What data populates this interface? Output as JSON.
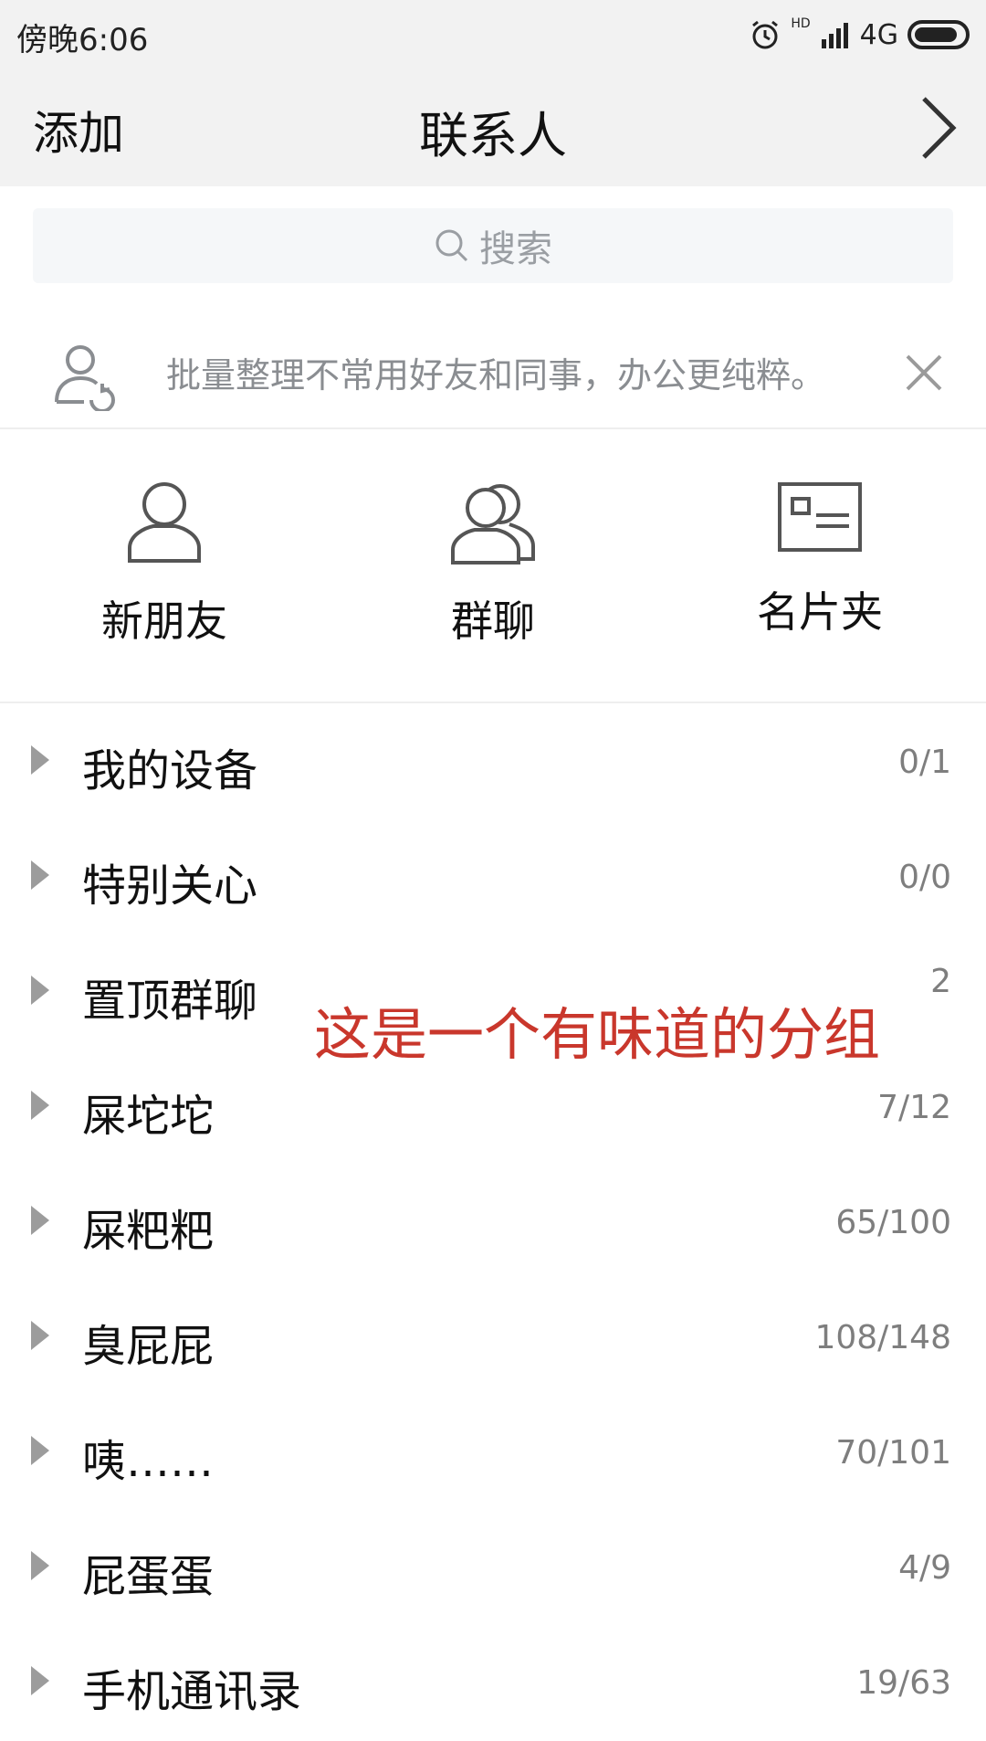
{
  "status_bar": {
    "time": "傍晚6:06",
    "hd": "HD",
    "network": "4G"
  },
  "nav": {
    "add_label": "添加",
    "title": "联系人"
  },
  "search": {
    "placeholder": "搜索"
  },
  "notice": {
    "text": "批量整理不常用好友和同事，办公更纯粹。"
  },
  "quick_actions": [
    {
      "label": "新朋友",
      "icon": "person-icon"
    },
    {
      "label": "群聊",
      "icon": "group-icon"
    },
    {
      "label": "名片夹",
      "icon": "card-icon"
    }
  ],
  "groups": [
    {
      "name": "我的设备",
      "count": "0/1"
    },
    {
      "name": "特别关心",
      "count": "0/0"
    },
    {
      "name": "置顶群聊",
      "count": "2"
    },
    {
      "name": "屎坨坨",
      "count": "7/12"
    },
    {
      "name": "屎粑粑",
      "count": "65/100"
    },
    {
      "name": "臭屁屁",
      "count": "108/148"
    },
    {
      "name": "咦……",
      "count": "70/101"
    },
    {
      "name": "屁蛋蛋",
      "count": "4/9"
    },
    {
      "name": "手机通讯录",
      "count": "19/63"
    }
  ],
  "annotation": {
    "text": "这是一个有味道的分组",
    "color": "#c9372c"
  }
}
